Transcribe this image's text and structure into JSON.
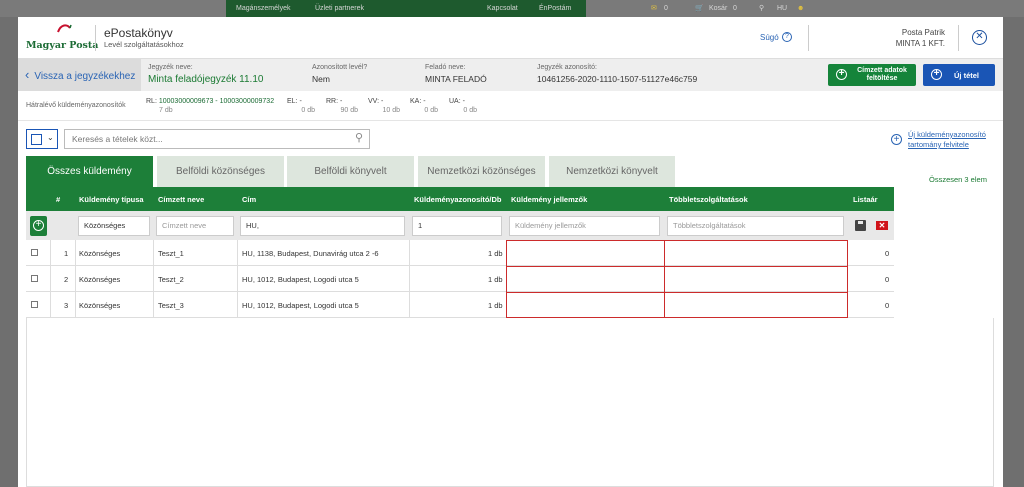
{
  "topbar": {
    "maganszemelyek": "Magánszemélyek",
    "uzleti": "Üzleti partnerek",
    "kapcsolat": "Kapcsolat",
    "enpostam": "ÉnPostám",
    "mail_count": "0",
    "cart_label": "Kosár",
    "cart_count": "0",
    "lang": "HU"
  },
  "header": {
    "logo_text": "Magyar Posta",
    "app_title": "ePostakönyv",
    "app_subtitle": "Levél szolgáltatásokhoz",
    "help": "Súgó",
    "user_name": "Posta Patrik",
    "company": "MINTA 1 KFT."
  },
  "infobar": {
    "back": "Vissza a jegyzékekhez",
    "jegyzek_label": "Jegyzék neve:",
    "jegyzek_value": "Minta feladójegyzék 11.10",
    "azon_label": "Azonosított levél?",
    "azon_value": "Nem",
    "felado_label": "Feladó neve:",
    "felado_value": "MINTA FELADÓ",
    "jegyzekazon_label": "Jegyzék azonosító:",
    "jegyzekazon_value": "10461256-2020-1110-1507-51127e46c759",
    "cimzett_btn": "Címzett adatok feltöltése",
    "uj_tetel_btn": "Új tétel"
  },
  "summary": {
    "hatralevo": "Hátralévő küldeményazonosítók",
    "rl_label": "RL:",
    "rl_range": "10003000009673 - 10003000009732",
    "rl_count": "7 db",
    "el_label": "EL: -",
    "el_count": "0 db",
    "rr_label": "RR: -",
    "rr_count": "90 db",
    "vv_label": "VV: -",
    "vv_count": "10 db",
    "ka_label": "KA: -",
    "ka_count": "0 db",
    "ua_label": "UA: -",
    "ua_count": "0 db"
  },
  "search": {
    "placeholder": "Keresés a tételek közt..."
  },
  "new_range": "Új küldeményazonosító tartomány felvitele",
  "tabs": [
    "Összes küldemény",
    "Belföldi közönséges",
    "Belföldi könyvelt",
    "Nemzetközi közönséges",
    "Nemzetközi könyvelt"
  ],
  "total": "Összesen 3 elem",
  "columns": {
    "num": "#",
    "tipus": "Küldemény típusa",
    "cimzett": "Címzett neve",
    "cim": "Cím",
    "azon": "Küldeményazonosító/Db",
    "jellemzok": "Küldemény jellemzők",
    "tobblet": "Többletszolgáltatások",
    "listaar": "Listaár"
  },
  "filters": {
    "tipus": "Közönséges",
    "cimzett": "Címzett neve",
    "cim": "HU,",
    "azon": "1",
    "jellemzok": "Küldemény jellemzők",
    "tobblet": "Többletszolgáltatások"
  },
  "rows": [
    {
      "num": "1",
      "tipus": "Közönséges",
      "cimzett": "Teszt_1",
      "cim": "HU, 1138, Budapest, Dunavirág utca 2 -6",
      "db": "1 db",
      "ar": "0"
    },
    {
      "num": "2",
      "tipus": "Közönséges",
      "cimzett": "Teszt_2",
      "cim": "HU, 1012, Budapest, Logodi utca 5",
      "db": "1 db",
      "ar": "0"
    },
    {
      "num": "3",
      "tipus": "Közönséges",
      "cimzett": "Teszt_3",
      "cim": "HU, 1012, Budapest, Logodi utca 5",
      "db": "1 db",
      "ar": "0"
    }
  ]
}
